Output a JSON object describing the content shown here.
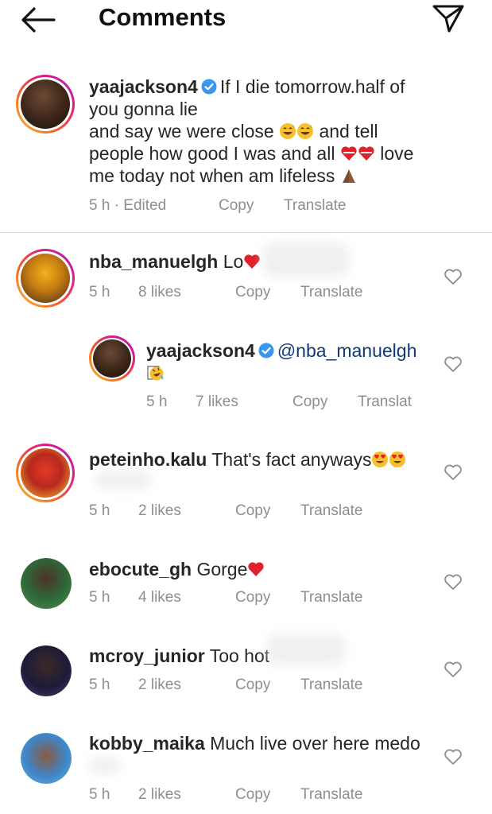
{
  "header": {
    "title": "Comments",
    "back_icon": "arrow-left-icon",
    "share_icon": "paper-plane-icon"
  },
  "caption": {
    "username": "yaajackson4",
    "verified": true,
    "line1": "If I die tomorrow.half of",
    "line2": "you gonna lie",
    "line3": "and say we were close",
    "line4a": "people how good I was and all",
    "line4b": "love",
    "line5": "me today not when am lifeless",
    "line3_tail": "and tell",
    "time": "5 h · Edited",
    "copy": "Copy",
    "translate": "Translate"
  },
  "comments": [
    {
      "username": "nba_manuelgh",
      "text": "Lo",
      "time": "5 h",
      "likes": "8 likes",
      "copy": "Copy",
      "translate": "Translate"
    },
    {
      "username": "yaajackson4",
      "verified": true,
      "mention": "@nba_manuelgh",
      "text": "",
      "time": "5 h",
      "likes": "7 likes",
      "copy": "Copy",
      "translate": "Translat",
      "reply": true
    },
    {
      "username": "peteinho.kalu",
      "text": "That's fact anyways",
      "time": "5 h",
      "likes": "2 likes",
      "copy": "Copy",
      "translate": "Translate"
    },
    {
      "username": "ebocute_gh",
      "text": "Gorge",
      "time": "5 h",
      "likes": "4 likes",
      "copy": "Copy",
      "translate": "Translate"
    },
    {
      "username": "mcroy_junior",
      "text": "Too hot",
      "time": "5 h",
      "likes": "2 likes",
      "copy": "Copy",
      "translate": "Translate"
    },
    {
      "username": "kobby_maika",
      "text": "Much live over here medo",
      "time": "5 h",
      "likes": "2 likes",
      "copy": "Copy",
      "translate": "Translate"
    }
  ],
  "colors": {
    "text": "#262626",
    "meta": "#8e8e8e",
    "mention": "#0f3a74",
    "verified": "#3897f0",
    "heart_red": "#e0202a"
  }
}
